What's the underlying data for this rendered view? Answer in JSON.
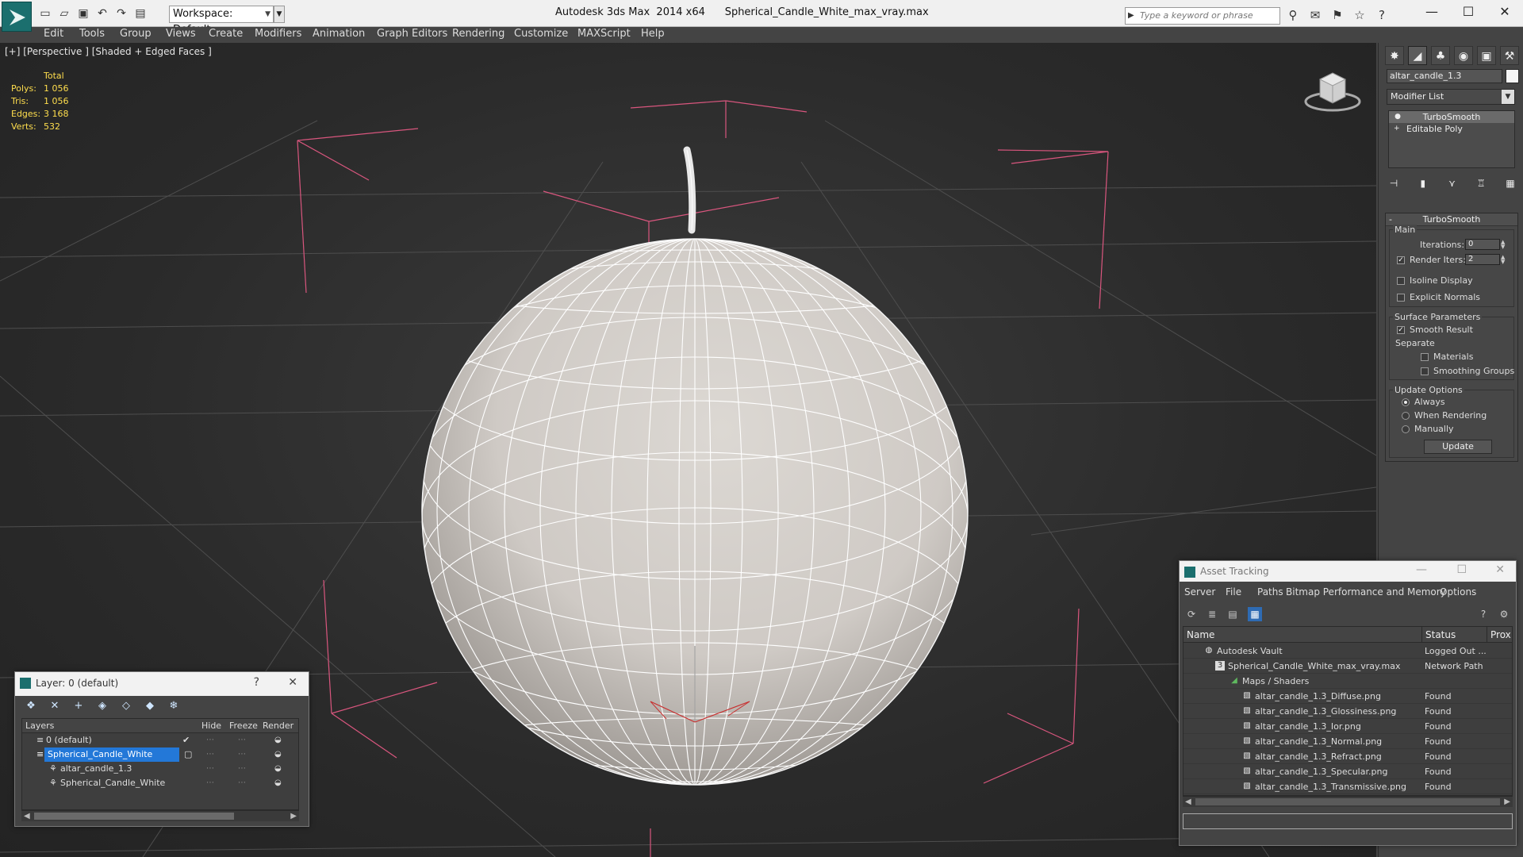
{
  "titlebar": {
    "workspace": "Workspace: Default",
    "app_title": "Autodesk 3ds Max  2014 x64",
    "file_title": "Spherical_Candle_White_max_vray.max",
    "search_placeholder": "Type a keyword or phrase"
  },
  "menu": [
    "Edit",
    "Tools",
    "Group",
    "Views",
    "Create",
    "Modifiers",
    "Animation",
    "Graph Editors",
    "Rendering",
    "Customize",
    "MAXScript",
    "Help"
  ],
  "viewport": {
    "label": "[+] [Perspective ] [Shaded + Edged Faces ]",
    "stats": {
      "header": "Total",
      "rows": [
        {
          "k": "Polys:",
          "v": "1 056"
        },
        {
          "k": "Tris:",
          "v": "1 056"
        },
        {
          "k": "Edges:",
          "v": "3 168"
        },
        {
          "k": "Verts:",
          "v": "532"
        }
      ]
    }
  },
  "command_panel": {
    "object_name": "altar_candle_1.3",
    "modifier_list": "Modifier List",
    "stack": [
      "TurboSmooth",
      "Editable Poly"
    ],
    "rollout": {
      "title": "TurboSmooth",
      "main": "Main",
      "iterations_label": "Iterations:",
      "iterations": "0",
      "render_iters_label": "Render Iters:",
      "render_iters": "2",
      "isoline": "Isoline Display",
      "explicit": "Explicit Normals",
      "surface": "Surface Parameters",
      "smooth_result": "Smooth Result",
      "separate": "Separate",
      "materials": "Materials",
      "smoothing_groups": "Smoothing Groups",
      "update_options": "Update Options",
      "always": "Always",
      "when_rendering": "When Rendering",
      "manually": "Manually",
      "update_btn": "Update"
    }
  },
  "layers": {
    "title": "Layer: 0 (default)",
    "help": "?",
    "columns": {
      "layers": "Layers",
      "hide": "Hide",
      "freeze": "Freeze",
      "render": "Render"
    },
    "rows": [
      "0 (default)",
      "Spherical_Candle_White",
      "altar_candle_1.3",
      "Spherical_Candle_White"
    ]
  },
  "asset_tracking": {
    "title": "Asset Tracking",
    "menu": [
      "Server",
      "File",
      "Paths",
      "Bitmap Performance and Memory",
      "Options"
    ],
    "columns": {
      "name": "Name",
      "status": "Status",
      "proxy": "Prox"
    },
    "rows": [
      {
        "name": "Autodesk Vault",
        "status": "Logged Out ..."
      },
      {
        "name": "Spherical_Candle_White_max_vray.max",
        "status": "Network Path"
      },
      {
        "name": "Maps / Shaders",
        "status": ""
      },
      {
        "name": "altar_candle_1.3_Diffuse.png",
        "status": "Found"
      },
      {
        "name": "altar_candle_1.3_Glossiness.png",
        "status": "Found"
      },
      {
        "name": "altar_candle_1.3_Ior.png",
        "status": "Found"
      },
      {
        "name": "altar_candle_1.3_Normal.png",
        "status": "Found"
      },
      {
        "name": "altar_candle_1.3_Refract.png",
        "status": "Found"
      },
      {
        "name": "altar_candle_1.3_Specular.png",
        "status": "Found"
      },
      {
        "name": "altar_candle_1.3_Transmissive.png",
        "status": "Found"
      }
    ]
  },
  "colors": {
    "selection": "#2378d8",
    "stats": "#ffde4d",
    "bbox": "#d9567e",
    "mesh": "#d6d2cd"
  }
}
